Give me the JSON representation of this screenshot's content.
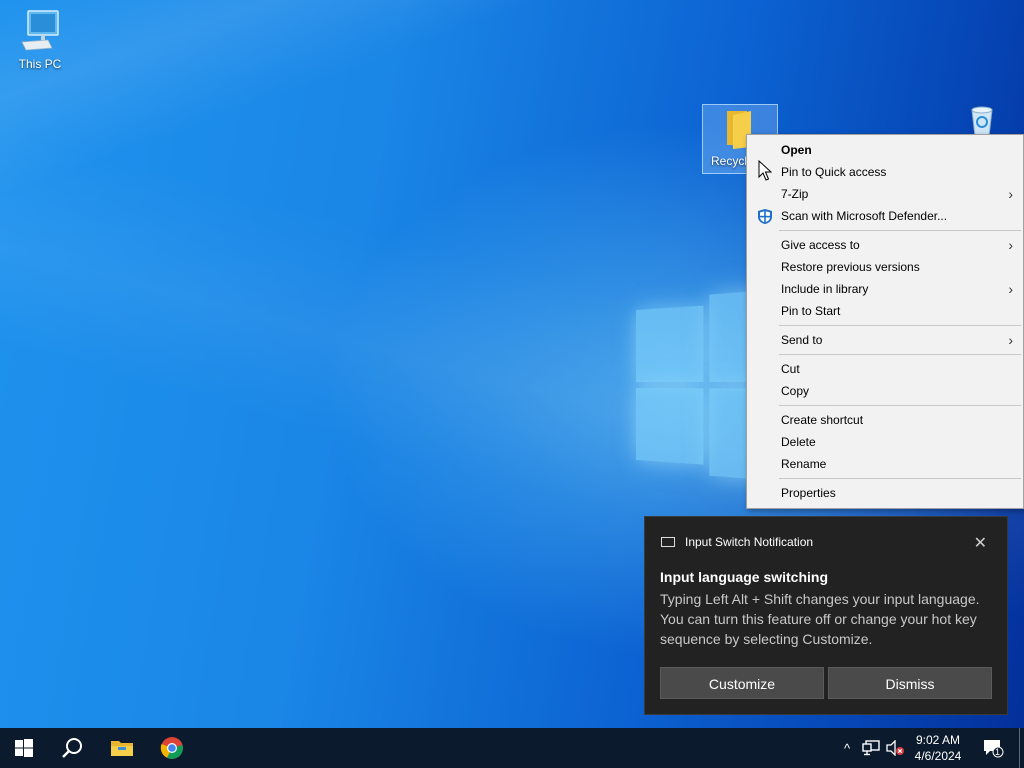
{
  "desktop": {
    "icons": [
      {
        "label": "This PC"
      },
      {
        "label": "Recycl"
      },
      {
        "label": ""
      }
    ]
  },
  "context_menu": {
    "items": [
      {
        "label": "Open",
        "bold": true
      },
      {
        "label": "Pin to Quick access"
      },
      {
        "label": "7-Zip",
        "submenu": true
      },
      {
        "label": "Scan with Microsoft Defender...",
        "icon": "defender-icon"
      },
      {
        "label": "Give access to",
        "submenu": true
      },
      {
        "label": "Restore previous versions"
      },
      {
        "label": "Include in library",
        "submenu": true
      },
      {
        "label": "Pin to Start"
      },
      {
        "label": "Send to",
        "submenu": true
      },
      {
        "label": "Cut"
      },
      {
        "label": "Copy"
      },
      {
        "label": "Create shortcut"
      },
      {
        "label": "Delete"
      },
      {
        "label": "Rename"
      },
      {
        "label": "Properties"
      }
    ],
    "submenu_glyph": "›"
  },
  "notification": {
    "app_name": "Input Switch Notification",
    "close_glyph": "✕",
    "title": "Input language switching",
    "body": "Typing Left Alt + Shift changes your input language. You can turn this feature off or change your hot key sequence by selecting Customize.",
    "buttons": {
      "customize": "Customize",
      "dismiss": "Dismiss"
    }
  },
  "taskbar": {
    "pinned": [
      "windows-start-icon",
      "search-icon",
      "file-explorer-icon",
      "chrome-icon"
    ],
    "tray": {
      "chevron_glyph": "^",
      "time": "9:02 AM",
      "date": "4/6/2024",
      "notification_count": "1"
    }
  },
  "colors": {
    "taskbar_bg": "#0b1a2c",
    "menu_bg": "#f2f2f2",
    "toast_bg": "#222222",
    "toast_button": "#4a4a4a",
    "accent": "#0078d7"
  }
}
